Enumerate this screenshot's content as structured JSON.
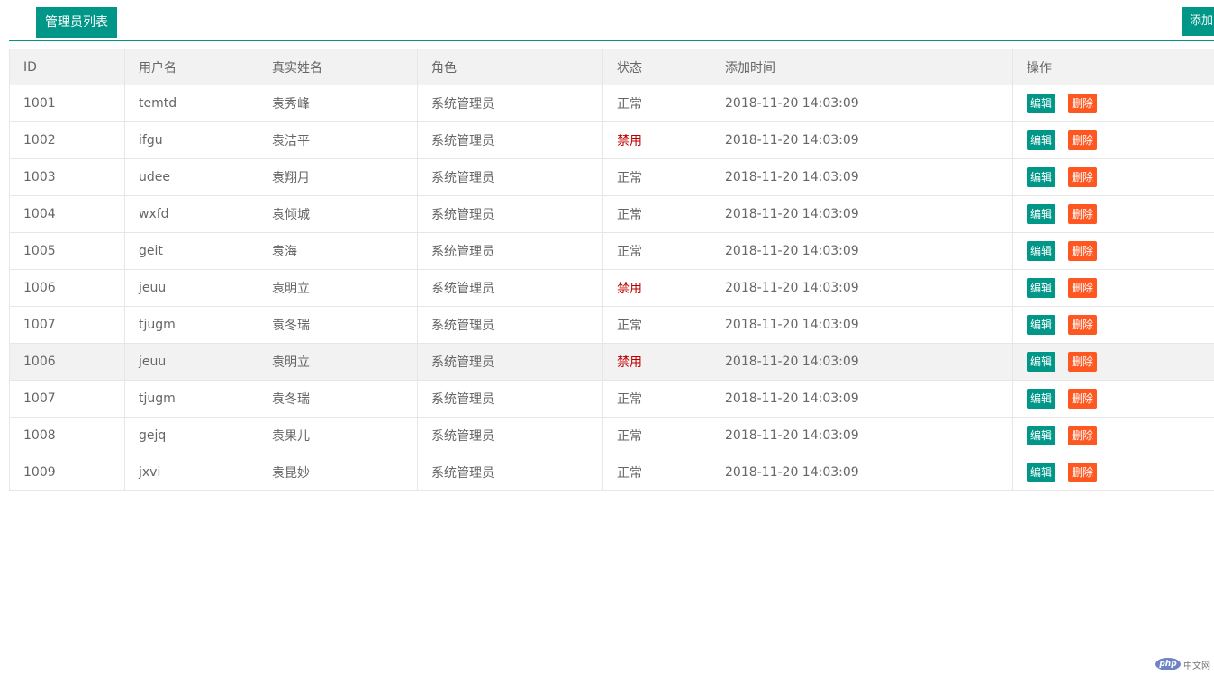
{
  "tabs": {
    "active_label": "管理员列表"
  },
  "toolbar": {
    "add_label": "添加"
  },
  "table": {
    "headers": [
      "ID",
      "用户名",
      "真实姓名",
      "角色",
      "状态",
      "添加时间",
      "操作"
    ],
    "edit_label": "编辑",
    "delete_label": "删除",
    "rows": [
      {
        "id": "1001",
        "username": "temtd",
        "realname": "袁秀峰",
        "role": "系统管理员",
        "status": "正常",
        "status_disabled": false,
        "time": "2018-11-20 14:03:09"
      },
      {
        "id": "1002",
        "username": "ifgu",
        "realname": "袁洁平",
        "role": "系统管理员",
        "status": "禁用",
        "status_disabled": true,
        "time": "2018-11-20 14:03:09"
      },
      {
        "id": "1003",
        "username": "udee",
        "realname": "袁翔月",
        "role": "系统管理员",
        "status": "正常",
        "status_disabled": false,
        "time": "2018-11-20 14:03:09"
      },
      {
        "id": "1004",
        "username": "wxfd",
        "realname": "袁倾城",
        "role": "系统管理员",
        "status": "正常",
        "status_disabled": false,
        "time": "2018-11-20 14:03:09"
      },
      {
        "id": "1005",
        "username": "geit",
        "realname": "袁海",
        "role": "系统管理员",
        "status": "正常",
        "status_disabled": false,
        "time": "2018-11-20 14:03:09"
      },
      {
        "id": "1006",
        "username": "jeuu",
        "realname": "袁明立",
        "role": "系统管理员",
        "status": "禁用",
        "status_disabled": true,
        "time": "2018-11-20 14:03:09"
      },
      {
        "id": "1007",
        "username": "tjugm",
        "realname": "袁冬瑞",
        "role": "系统管理员",
        "status": "正常",
        "status_disabled": false,
        "time": "2018-11-20 14:03:09"
      },
      {
        "id": "1006",
        "username": "jeuu",
        "realname": "袁明立",
        "role": "系统管理员",
        "status": "禁用",
        "status_disabled": true,
        "time": "2018-11-20 14:03:09",
        "hover": true
      },
      {
        "id": "1007",
        "username": "tjugm",
        "realname": "袁冬瑞",
        "role": "系统管理员",
        "status": "正常",
        "status_disabled": false,
        "time": "2018-11-20 14:03:09"
      },
      {
        "id": "1008",
        "username": "gejq",
        "realname": "袁果儿",
        "role": "系统管理员",
        "status": "正常",
        "status_disabled": false,
        "time": "2018-11-20 14:03:09"
      },
      {
        "id": "1009",
        "username": "jxvi",
        "realname": "袁昆妙",
        "role": "系统管理员",
        "status": "正常",
        "status_disabled": false,
        "time": "2018-11-20 14:03:09"
      }
    ]
  },
  "watermark": {
    "logo": "php",
    "text": "中文网"
  },
  "colors": {
    "accent": "#009688",
    "danger": "#ff5722",
    "disabled_text": "#c00000"
  }
}
